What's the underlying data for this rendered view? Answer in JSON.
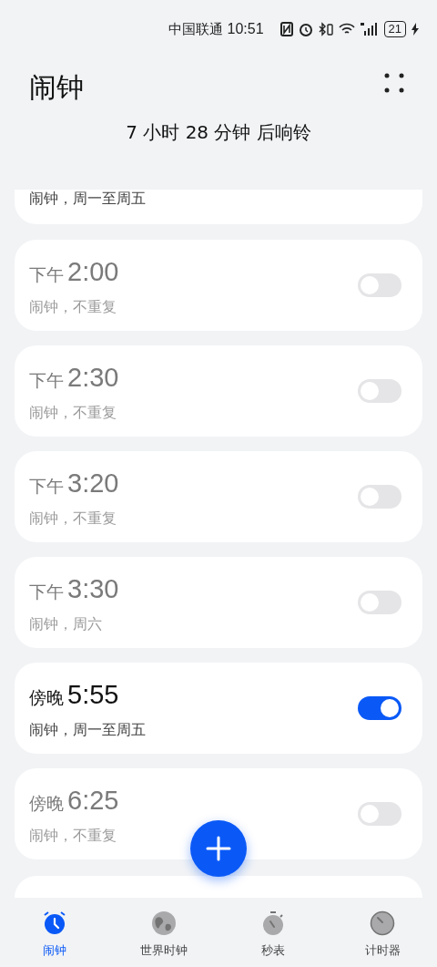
{
  "status_bar": {
    "carrier": "中国联通",
    "time": "10:51",
    "battery": "21"
  },
  "header": {
    "title": "闹钟",
    "countdown": "7 小时 28 分钟 后响铃"
  },
  "alarms": [
    {
      "kind": "partial",
      "repeat": "闹钟，周一至周五",
      "on": true
    },
    {
      "kind": "full",
      "period": "下午",
      "time": "2:00",
      "repeat": "闹钟，不重复",
      "on": false
    },
    {
      "kind": "full",
      "period": "下午",
      "time": "2:30",
      "repeat": "闹钟，不重复",
      "on": false
    },
    {
      "kind": "full",
      "period": "下午",
      "time": "3:20",
      "repeat": "闹钟，不重复",
      "on": false
    },
    {
      "kind": "full",
      "period": "下午",
      "time": "3:30",
      "repeat": "闹钟，周六",
      "on": false
    },
    {
      "kind": "full",
      "period": "傍晚",
      "time": "5:55",
      "repeat": "闹钟，周一至周五",
      "on": true
    },
    {
      "kind": "full",
      "period": "傍晚",
      "time": "6:25",
      "repeat": "闹钟，不重复",
      "on": false
    }
  ],
  "tabs": [
    {
      "label": "闹钟",
      "selected": true,
      "kind": "alarm"
    },
    {
      "label": "世界时钟",
      "selected": false,
      "kind": "world"
    },
    {
      "label": "秒表",
      "selected": false,
      "kind": "stopwatch"
    },
    {
      "label": "计时器",
      "selected": false,
      "kind": "timer"
    }
  ]
}
